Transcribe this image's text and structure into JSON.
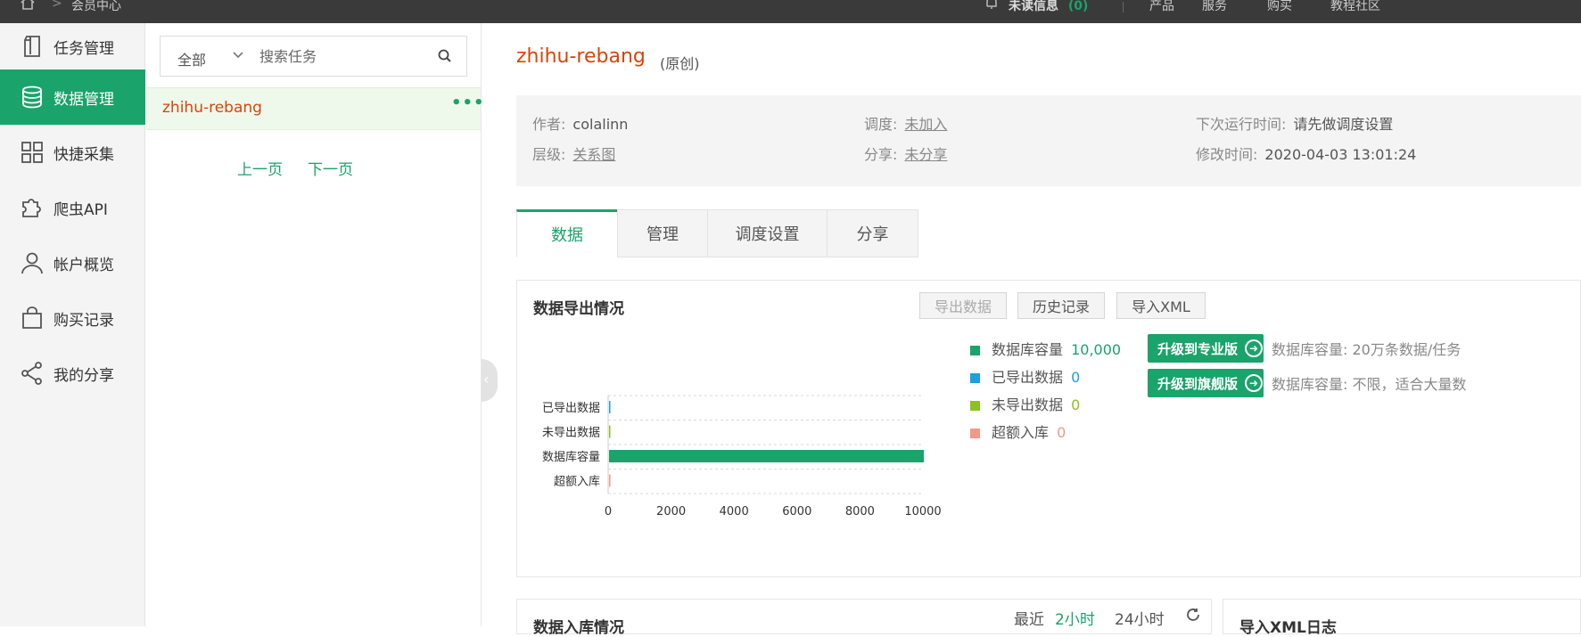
{
  "topbar": {
    "breadcrumb": "会员中心",
    "messages": "未读信息",
    "message_count": "(0)",
    "links": [
      "产品",
      "服务",
      "购买",
      "教程",
      "社区"
    ]
  },
  "sidebar": {
    "items": [
      {
        "label": "任务管理",
        "icon": "document-icon"
      },
      {
        "label": "数据管理",
        "icon": "database-icon",
        "active": true
      },
      {
        "label": "快捷采集",
        "icon": "grid-icon"
      },
      {
        "label": "爬虫API",
        "icon": "puzzle-icon"
      },
      {
        "label": "帐户概览",
        "icon": "user-icon"
      },
      {
        "label": "购买记录",
        "icon": "bag-icon"
      },
      {
        "label": "我的分享",
        "icon": "share-icon"
      }
    ]
  },
  "tasklist": {
    "filter": "全部",
    "search_placeholder": "搜索任务",
    "task_name": "zhihu-rebang",
    "more": "•••",
    "prev": "上一页",
    "next": "下一页"
  },
  "main": {
    "title": "zhihu-rebang",
    "tag": "(原创)",
    "info": {
      "author_label": "作者:",
      "author": "colalinn",
      "schedule_label": "调度:",
      "schedule": "未加入",
      "next_run_label": "下次运行时间:",
      "next_run": "请先做调度设置",
      "level_label": "层级:",
      "level": "关系图",
      "share_label": "分享:",
      "share": "未分享",
      "modified_label": "修改时间:",
      "modified": "2020-04-03 13:01:24"
    },
    "tabs": [
      "数据",
      "管理",
      "调度设置",
      "分享"
    ],
    "export_panel": {
      "title": "数据导出情况",
      "export_btn": "导出数据",
      "history_btn": "历史记录",
      "import_btn": "导入XML"
    },
    "legend": [
      {
        "label": "数据库容量",
        "value": "10,000",
        "color": "#1aa36b"
      },
      {
        "label": "已导出数据",
        "value": "0",
        "color": "#1ba0e1"
      },
      {
        "label": "未导出数据",
        "value": "0",
        "color": "#8cc11f"
      },
      {
        "label": "超额入库",
        "value": "0",
        "color": "#f0998a"
      }
    ],
    "upgrades": [
      {
        "label": "升级到专业版",
        "desc": "数据库容量: 20万条数据/任务"
      },
      {
        "label": "升级到旗舰版",
        "desc": "数据库容量: 不限，适合大量数"
      }
    ],
    "ingest_panel": {
      "title": "数据入库情况",
      "recent": "最近",
      "opt1": "2小时",
      "opt2": "24小时"
    },
    "xml_panel": {
      "title": "导入XML日志"
    }
  },
  "chart_data": {
    "type": "bar",
    "orientation": "horizontal",
    "categories": [
      "已导出数据",
      "未导出数据",
      "数据库容量",
      "超额入库"
    ],
    "values": [
      0,
      0,
      10000,
      0
    ],
    "colors": [
      "#1ba0e1",
      "#8cc11f",
      "#1aa36b",
      "#f0998a"
    ],
    "xticks": [
      "0",
      "2000",
      "4000",
      "6000",
      "8000",
      "10000"
    ],
    "xlim": [
      0,
      10000
    ],
    "grid": true
  }
}
